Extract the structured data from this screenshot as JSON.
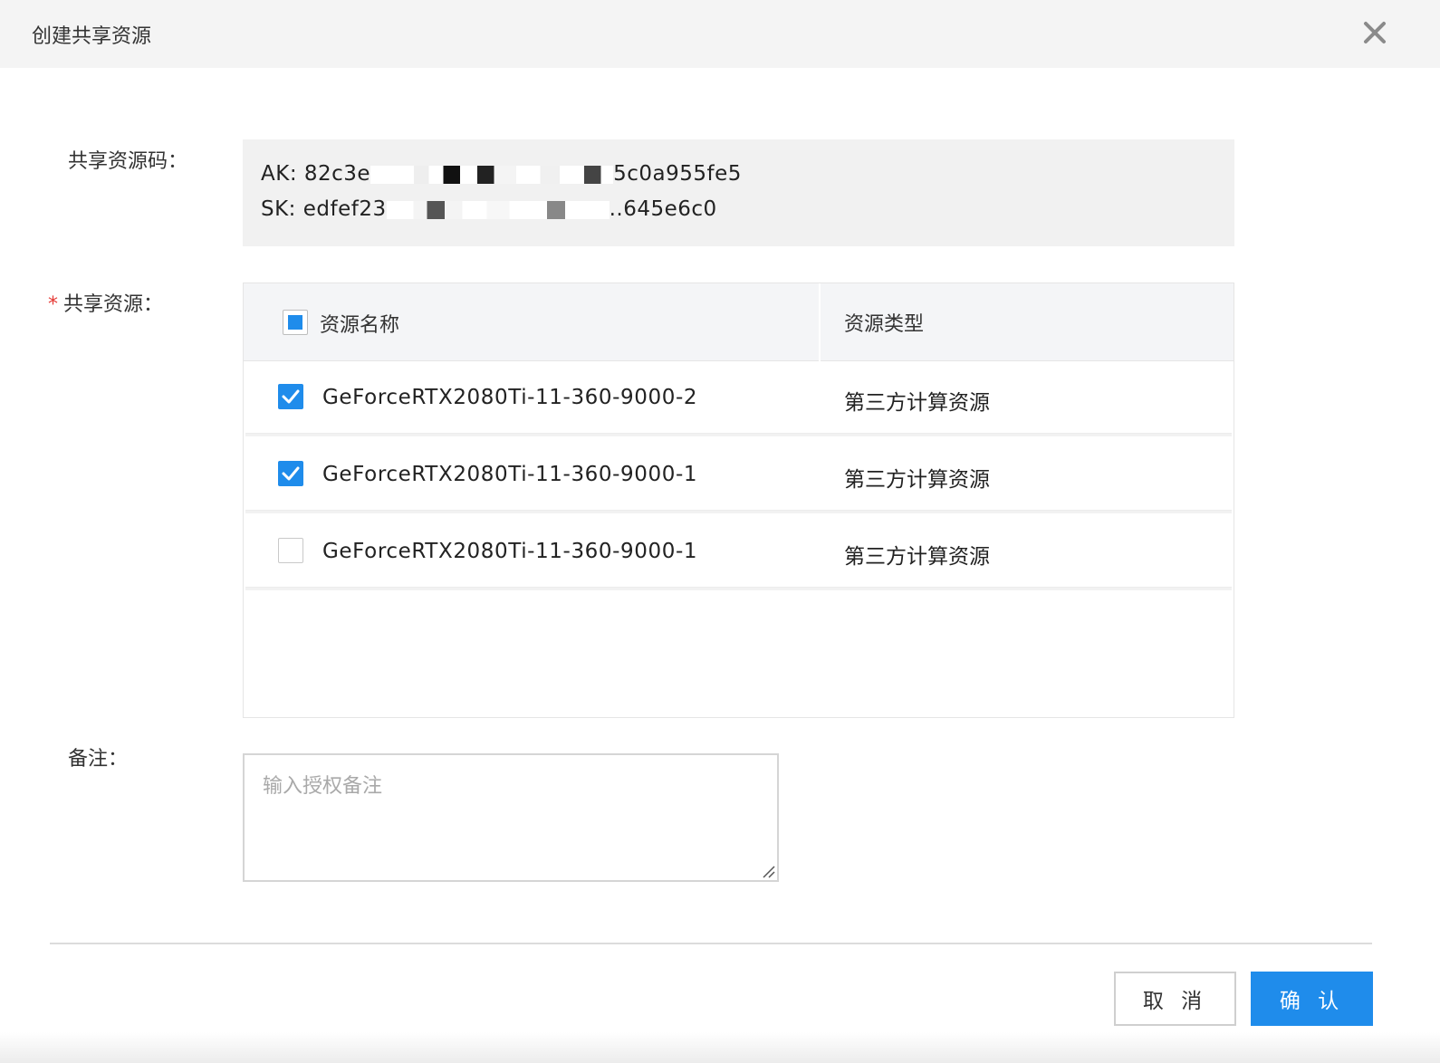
{
  "dialog": {
    "title": "创建共享资源",
    "close_icon": "close-icon"
  },
  "code_section": {
    "label": "共享资源码：",
    "ak_prefix": "AK: 82c3e",
    "ak_suffix": "5c0a955fe5",
    "sk_prefix": "SK: edfef23",
    "sk_suffix": "..645e6c0"
  },
  "resources": {
    "required_mark": "*",
    "label": "共享资源：",
    "header": {
      "name": "资源名称",
      "type": "资源类型",
      "select_all_state": "partial"
    },
    "rows": [
      {
        "name": "GeForceRTX2080Ti-11-360-9000-2",
        "type": "第三方计算资源",
        "checked": true
      },
      {
        "name": "GeForceRTX2080Ti-11-360-9000-1",
        "type": "第三方计算资源",
        "checked": true
      },
      {
        "name": "GeForceRTX2080Ti-11-360-9000-1",
        "type": "第三方计算资源",
        "checked": false
      }
    ]
  },
  "remark": {
    "label": "备注：",
    "placeholder": "输入授权备注",
    "value": ""
  },
  "footer": {
    "cancel_label": "取 消",
    "confirm_label": "确 认"
  },
  "colors": {
    "accent": "#1f8ceb",
    "required": "#e53935",
    "header_bg": "#f4f4f4"
  }
}
